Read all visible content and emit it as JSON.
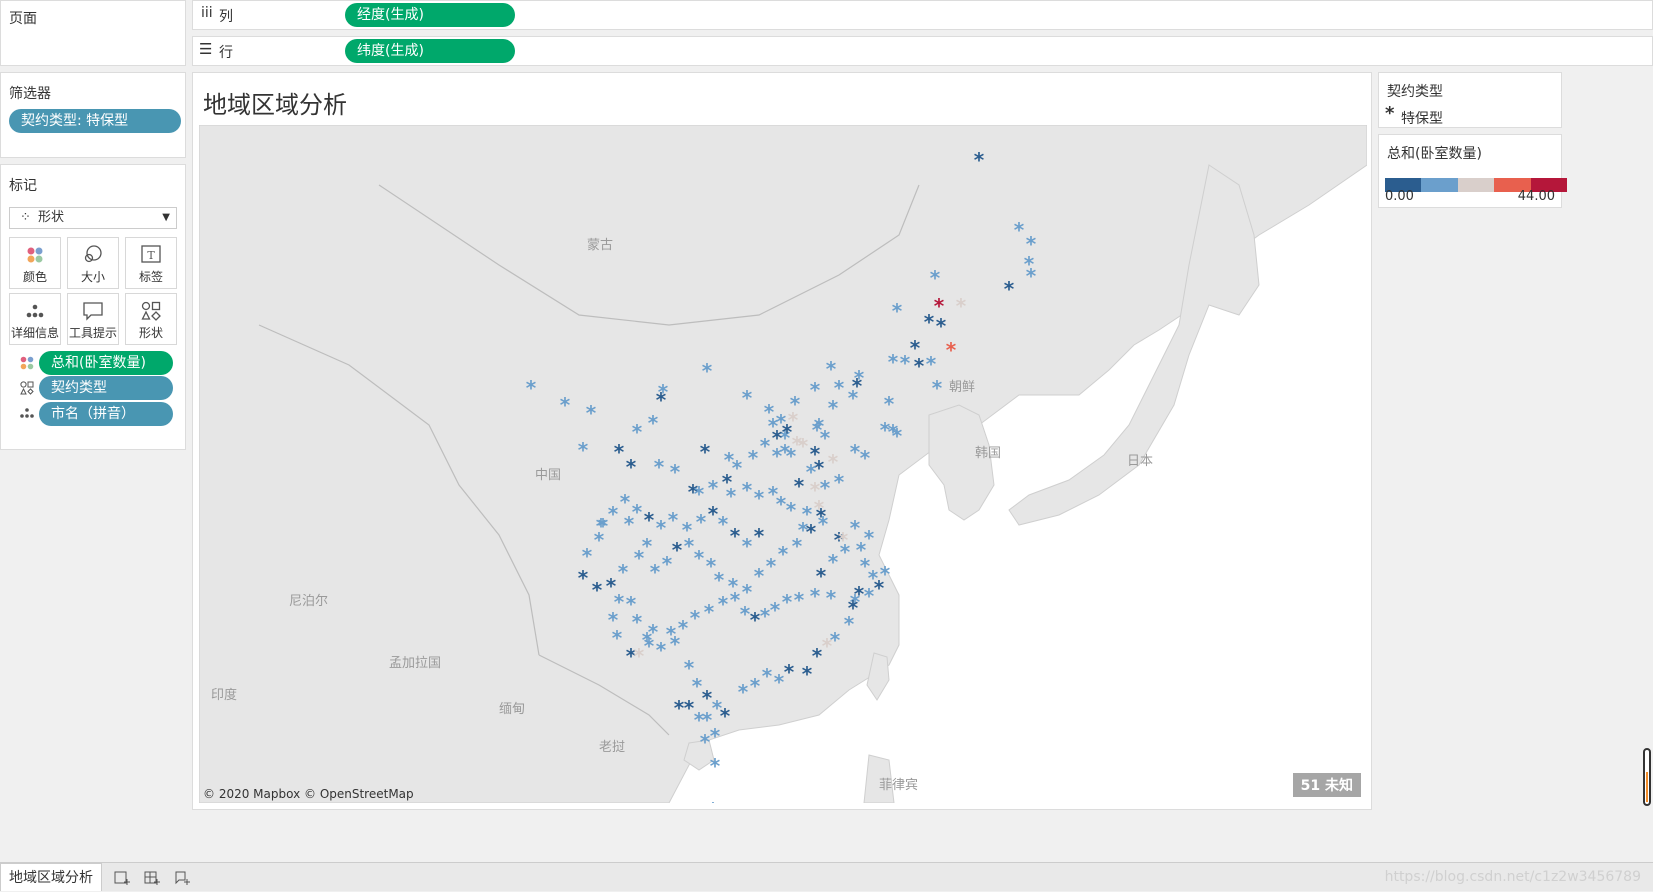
{
  "pages_shelf": {
    "title": "页面"
  },
  "columns_shelf": {
    "label": "列",
    "pill": "经度(生成)"
  },
  "rows_shelf": {
    "label": "行",
    "pill": "纬度(生成)"
  },
  "filters": {
    "title": "筛选器",
    "pill": "契约类型: 特保型"
  },
  "marks": {
    "title": "标记",
    "mark_type": "形状",
    "buttons": [
      {
        "label": "颜色",
        "icon": "color-icon"
      },
      {
        "label": "大小",
        "icon": "size-icon"
      },
      {
        "label": "标签",
        "icon": "label-icon"
      },
      {
        "label": "详细信息",
        "icon": "detail-icon"
      },
      {
        "label": "工具提示",
        "icon": "tooltip-icon"
      },
      {
        "label": "形状",
        "icon": "shape-icon"
      }
    ],
    "fields": [
      "总和(卧室数量)",
      "契约类型",
      "市名（拼音）"
    ]
  },
  "view": {
    "title": "地域区域分析",
    "attribution": "© 2020 Mapbox © OpenStreetMap",
    "unknown_badge": "51 未知",
    "map_labels": [
      "蒙古",
      "中国",
      "朝鲜",
      "韩国",
      "日本",
      "印度",
      "缅甸",
      "老挝",
      "尼泊尔",
      "孟加拉国",
      "菲律宾"
    ]
  },
  "shape_legend": {
    "title": "契约类型",
    "item": "特保型"
  },
  "color_legend": {
    "title": "总和(卧室数量)",
    "min": "0.00",
    "max": "44.00",
    "colors": [
      "#2b5d8f",
      "#6b9fcc",
      "#d9cfcb",
      "#e8604e",
      "#b5173a"
    ]
  },
  "sheet_tab": {
    "label": "地域区域分析"
  },
  "watermark": "https://blog.csdn.net/c1z2w3456789"
}
